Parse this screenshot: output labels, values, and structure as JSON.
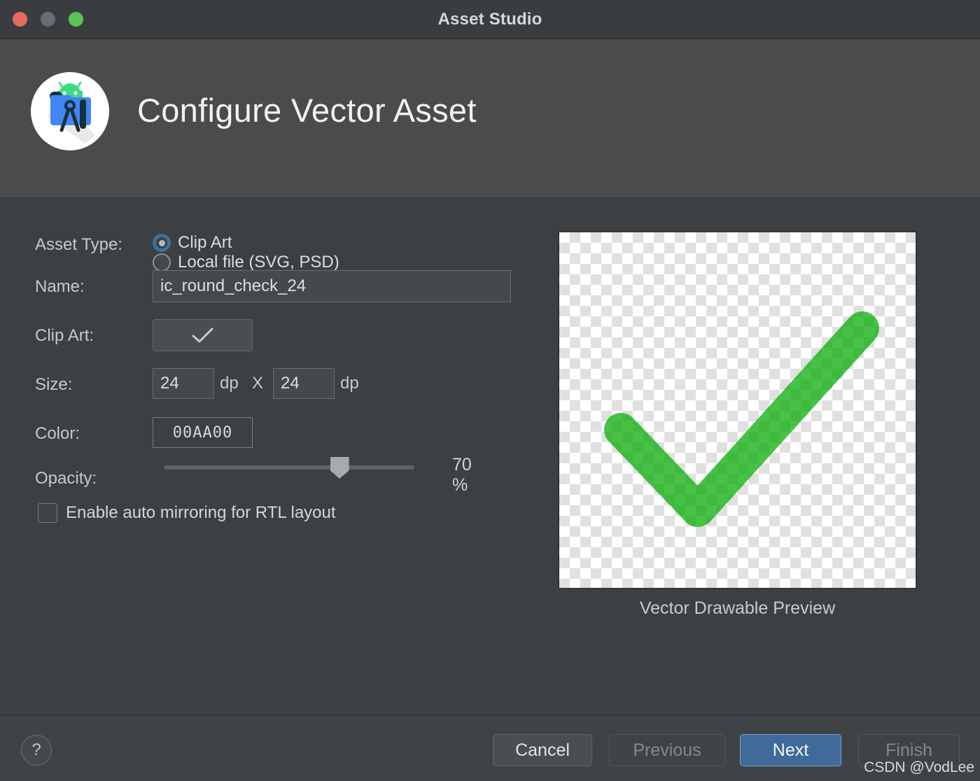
{
  "window": {
    "title": "Asset Studio",
    "traffic_lights": [
      "close",
      "minimize",
      "zoom"
    ]
  },
  "header": {
    "title": "Configure Vector Asset",
    "icon": "android-studio-asset-icon"
  },
  "form": {
    "asset_type": {
      "label": "Asset Type:",
      "options": [
        {
          "label": "Clip Art",
          "selected": true
        },
        {
          "label": "Local file (SVG, PSD)",
          "selected": false
        }
      ]
    },
    "name": {
      "label": "Name:",
      "value": "ic_round_check_24"
    },
    "clip_art": {
      "label": "Clip Art:",
      "icon": "check-icon"
    },
    "size": {
      "label": "Size:",
      "width_value": "24",
      "height_value": "24",
      "unit_1": "dp",
      "separator": "X",
      "unit_2": "dp"
    },
    "color": {
      "label": "Color:",
      "value": "00AA00",
      "hex": "#00AA00"
    },
    "opacity": {
      "label": "Opacity:",
      "percent": 70,
      "display": "70 %"
    },
    "rtl": {
      "label": "Enable auto mirroring for RTL layout",
      "checked": false
    }
  },
  "preview": {
    "caption": "Vector Drawable Preview",
    "glyph": "check-icon",
    "stroke_color": "#00AA00",
    "stroke_opacity": 0.7
  },
  "footer": {
    "help": "?",
    "cancel": "Cancel",
    "previous": "Previous",
    "next": "Next",
    "finish": "Finish"
  },
  "watermark": "CSDN @VodLee"
}
